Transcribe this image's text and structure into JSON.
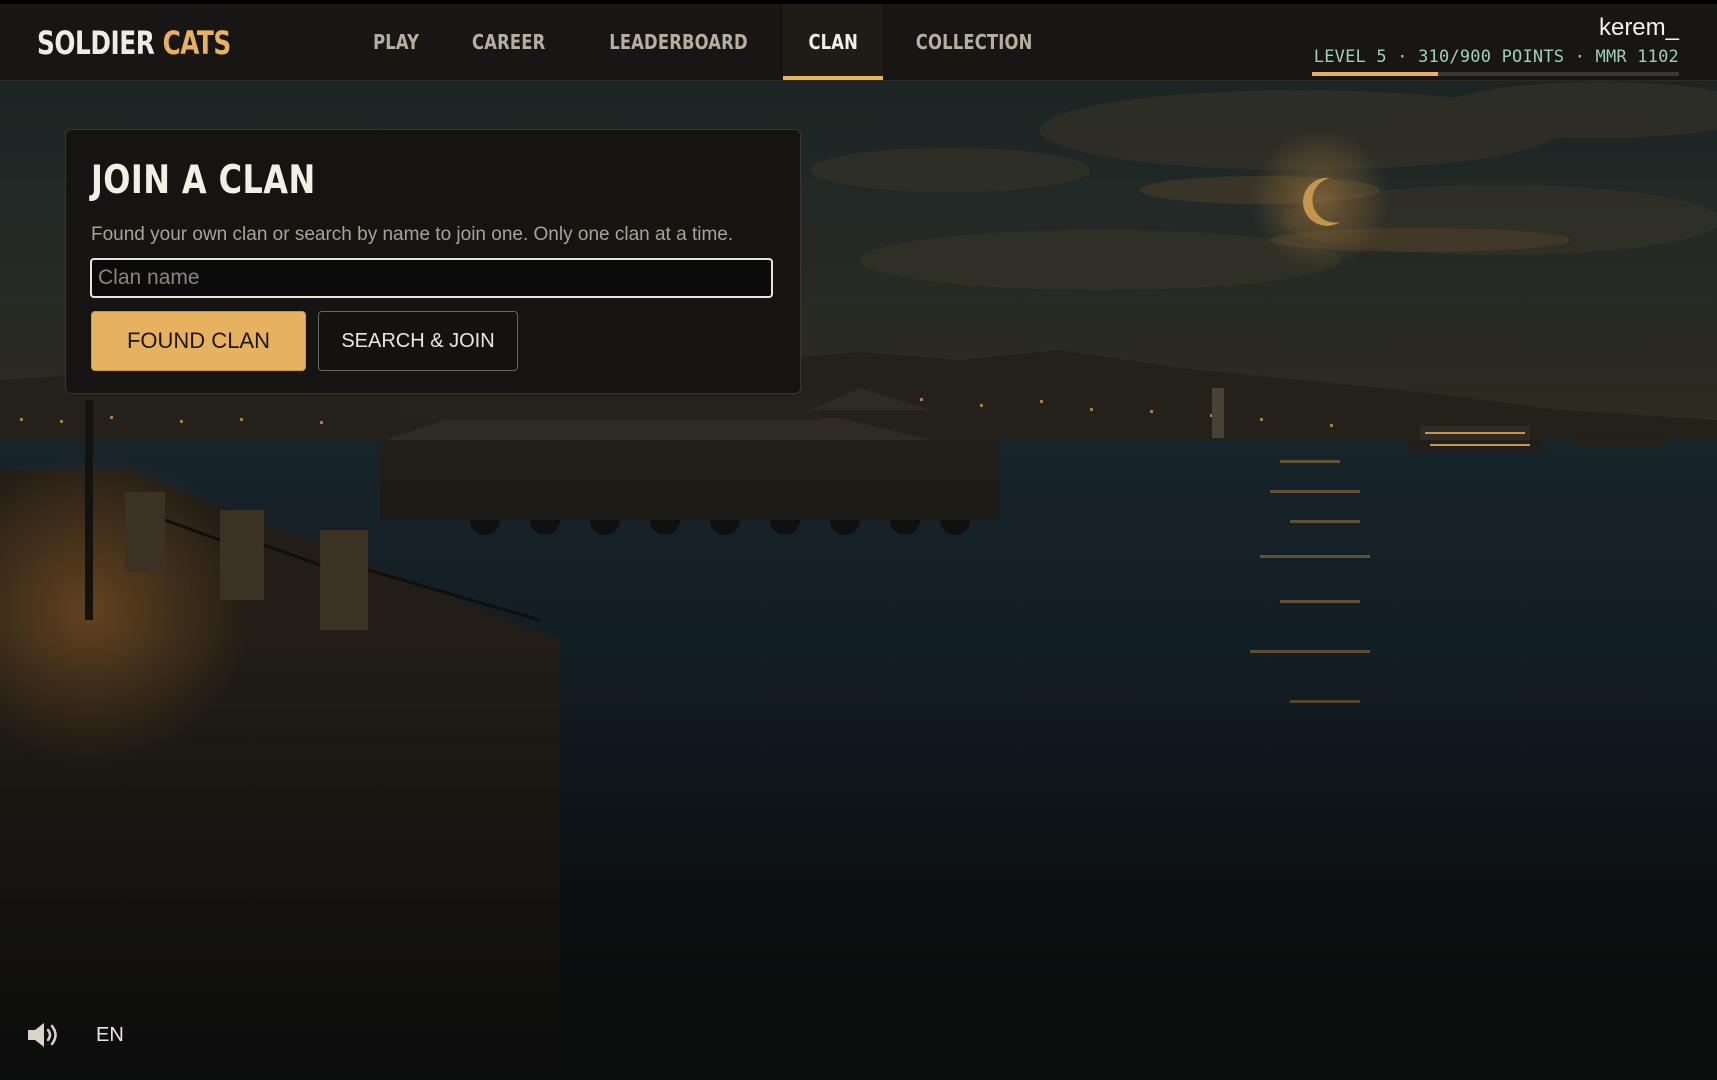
{
  "app": {
    "logo_main": "SOLDIER",
    "logo_accent": "CATS"
  },
  "nav": {
    "items": [
      {
        "label": "PLAY"
      },
      {
        "label": "CAREER"
      },
      {
        "label": "LEADERBOARD"
      },
      {
        "label": "CLAN",
        "active": true
      },
      {
        "label": "COLLECTION"
      }
    ]
  },
  "user": {
    "username": "kerem_",
    "stats": "LEVEL 5 · 310/900 POINTS · MMR 1102",
    "xp_progress_fraction": 0.344
  },
  "clan_card": {
    "title": "JOIN A CLAN",
    "description": "Found your own clan or search by name to join one. Only one clan at a time.",
    "input_value": "",
    "input_placeholder": "Clan name",
    "found_button": "FOUND CLAN",
    "search_button": "SEARCH & JOIN"
  },
  "footer": {
    "sound_icon": "speaker-icon",
    "language": "EN"
  },
  "colors": {
    "accent": "#e9b05d",
    "stats_text": "#9fd0b8",
    "bar_bg": "#181614"
  }
}
